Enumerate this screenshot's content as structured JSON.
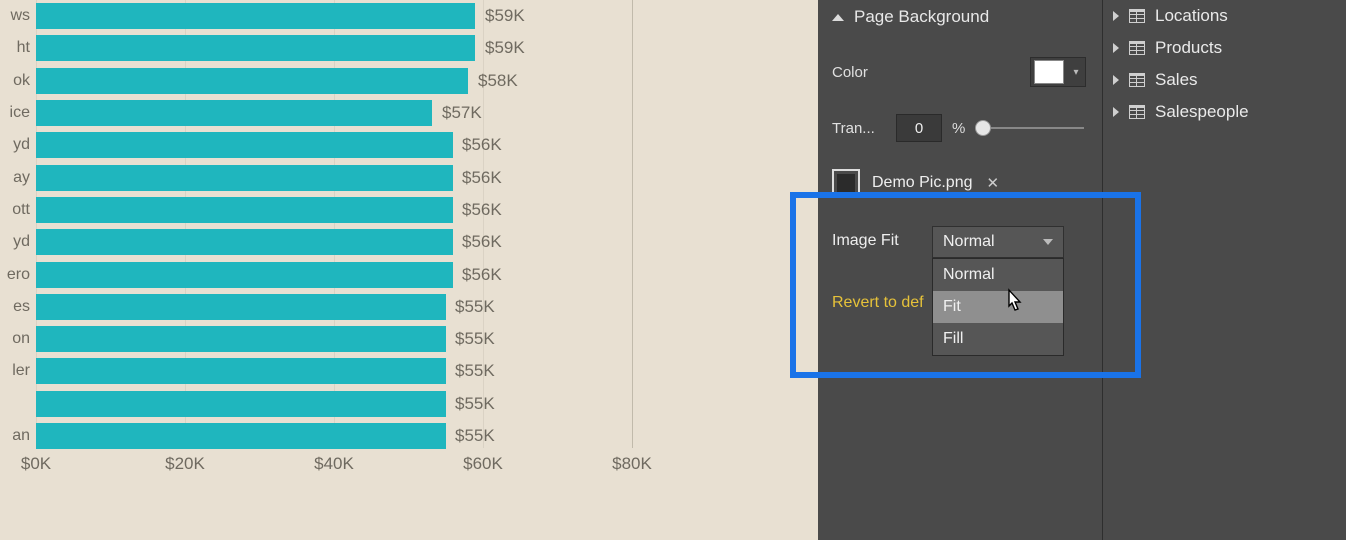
{
  "chart_data": {
    "type": "bar",
    "orientation": "horizontal",
    "xlabel": "",
    "ylabel": "",
    "xlim": [
      0,
      80
    ],
    "ticks": [
      "$0K",
      "$20K",
      "$40K",
      "$60K",
      "$80K"
    ],
    "categories": [
      "ws",
      "ht",
      "ok",
      "ice",
      "yd",
      "ay",
      "ott",
      "yd",
      "ero",
      "es",
      "on",
      "ler",
      "",
      "an"
    ],
    "values": [
      59,
      59,
      58,
      57,
      56,
      56,
      56,
      56,
      56,
      55,
      55,
      55,
      55,
      55
    ],
    "value_labels": [
      "$59K",
      "$59K",
      "$58K",
      "$57K",
      "$56K",
      "$56K",
      "$56K",
      "$56K",
      "$56K",
      "$55K",
      "$55K",
      "$55K",
      "$55K",
      "$55K"
    ],
    "bar_color": "#1fb6be"
  },
  "format": {
    "section_title": "Page Background",
    "color_label": "Color",
    "color_value": "#ffffff",
    "transparency_label": "Tran...",
    "transparency_value": "0",
    "transparency_unit": "%",
    "image_file": "Demo Pic.png",
    "image_fit_label": "Image Fit",
    "image_fit_selected": "Normal",
    "image_fit_options": [
      "Normal",
      "Fit",
      "Fill"
    ],
    "revert_label": "Revert to def"
  },
  "fields": {
    "items": [
      {
        "label": "Locations"
      },
      {
        "label": "Products"
      },
      {
        "label": "Sales"
      },
      {
        "label": "Salespeople"
      }
    ]
  }
}
